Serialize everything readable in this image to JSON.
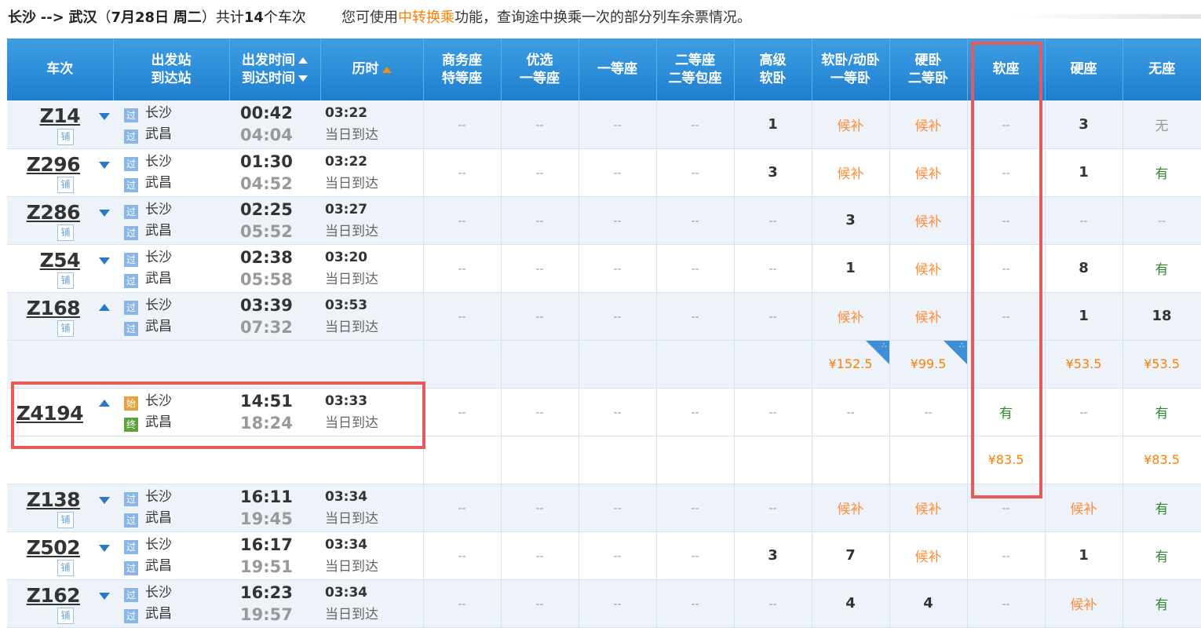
{
  "header": {
    "route_from": "长沙",
    "route_arrow": "-->",
    "route_to": "武汉",
    "date_paren_open": "（",
    "date": "7月28日",
    "weekday": "周二",
    "date_paren_close": "）",
    "total_prefix": "共计",
    "total_count": "14",
    "total_suffix": "个车次",
    "tip_prefix": "您可使用",
    "tip_link": "中转换乘",
    "tip_suffix": "功能，查询途中换乘一次的部分列车余票情况。"
  },
  "columns": {
    "train": "车次",
    "station_1": "出发站",
    "station_2": "到达站",
    "time_1": "出发时间",
    "time_2": "到达时间",
    "duration": "历时",
    "business_1": "商务座",
    "business_2": "特等座",
    "premium_1": "优选",
    "premium_2": "一等座",
    "first": "一等座",
    "second_1": "二等座",
    "second_2": "二等包座",
    "adv_soft_sleeper_1": "高级",
    "adv_soft_sleeper_2": "软卧",
    "soft_sleeper_1": "软卧/动卧",
    "soft_sleeper_2": "一等卧",
    "hard_sleeper_1": "硬卧",
    "hard_sleeper_2": "二等卧",
    "soft_seat": "软座",
    "hard_seat": "硬座",
    "no_seat": "无座"
  },
  "rows": [
    {
      "train": "Z14",
      "sleeper_badge": "铺",
      "arrow": "down",
      "from": "长沙",
      "to": "武昌",
      "from_icon": "过",
      "to_icon": "过",
      "dep": "00:42",
      "arr": "04:04",
      "dur": "03:22",
      "arr_day": "当日到达",
      "seats": [
        "--",
        "--",
        "--",
        "--",
        "1",
        "候补",
        "候补",
        "--",
        "3",
        "无"
      ]
    },
    {
      "train": "Z296",
      "sleeper_badge": "铺",
      "arrow": "down",
      "from": "长沙",
      "to": "武昌",
      "from_icon": "过",
      "to_icon": "过",
      "dep": "01:30",
      "arr": "04:52",
      "dur": "03:22",
      "arr_day": "当日到达",
      "seats": [
        "--",
        "--",
        "--",
        "--",
        "3",
        "候补",
        "候补",
        "--",
        "1",
        "有"
      ]
    },
    {
      "train": "Z286",
      "sleeper_badge": "铺",
      "arrow": "down",
      "from": "长沙",
      "to": "武昌",
      "from_icon": "过",
      "to_icon": "过",
      "dep": "02:25",
      "arr": "05:52",
      "dur": "03:27",
      "arr_day": "当日到达",
      "seats": [
        "--",
        "--",
        "--",
        "--",
        "--",
        "3",
        "候补",
        "--",
        "--",
        "--"
      ]
    },
    {
      "train": "Z54",
      "sleeper_badge": "铺",
      "arrow": "down",
      "from": "长沙",
      "to": "武昌",
      "from_icon": "过",
      "to_icon": "过",
      "dep": "02:38",
      "arr": "05:58",
      "dur": "03:20",
      "arr_day": "当日到达",
      "seats": [
        "--",
        "--",
        "--",
        "--",
        "--",
        "1",
        "候补",
        "--",
        "8",
        "有"
      ]
    },
    {
      "train": "Z168",
      "sleeper_badge": "铺",
      "arrow": "up",
      "from": "长沙",
      "to": "武昌",
      "from_icon": "过",
      "to_icon": "过",
      "dep": "03:39",
      "arr": "07:32",
      "dur": "03:53",
      "arr_day": "当日到达",
      "seats": [
        "--",
        "--",
        "--",
        "--",
        "--",
        "候补",
        "候补",
        "--",
        "1",
        "18"
      ]
    }
  ],
  "price_row_1": [
    "",
    "",
    "",
    "",
    "",
    "¥152.5",
    "¥99.5",
    "",
    "¥53.5",
    "¥53.5"
  ],
  "highlight_train": {
    "train": "Z4194",
    "arrow": "up",
    "from": "长沙",
    "to": "武昌",
    "from_icon": "始",
    "to_icon": "终",
    "dep": "14:51",
    "arr": "18:24",
    "dur": "03:33",
    "arr_day": "当日到达",
    "seats": [
      "--",
      "--",
      "--",
      "--",
      "--",
      "--",
      "--",
      "有",
      "--",
      "有"
    ]
  },
  "price_row_2": [
    "",
    "",
    "",
    "",
    "",
    "",
    "",
    "¥83.5",
    "",
    "¥83.5"
  ],
  "rows_after": [
    {
      "train": "Z138",
      "sleeper_badge": "铺",
      "arrow": "down",
      "from": "长沙",
      "to": "武昌",
      "from_icon": "过",
      "to_icon": "过",
      "dep": "16:11",
      "arr": "19:45",
      "dur": "03:34",
      "arr_day": "当日到达",
      "seats": [
        "--",
        "--",
        "--",
        "--",
        "--",
        "候补",
        "候补",
        "--",
        "候补",
        "有"
      ]
    },
    {
      "train": "Z502",
      "sleeper_badge": "铺",
      "arrow": "down",
      "from": "长沙",
      "to": "武昌",
      "from_icon": "过",
      "to_icon": "过",
      "dep": "16:17",
      "arr": "19:51",
      "dur": "03:34",
      "arr_day": "当日到达",
      "seats": [
        "--",
        "--",
        "--",
        "--",
        "3",
        "7",
        "候补",
        "--",
        "1",
        "有"
      ]
    },
    {
      "train": "Z162",
      "sleeper_badge": "铺",
      "arrow": "down",
      "from": "长沙",
      "to": "武昌",
      "from_icon": "过",
      "to_icon": "过",
      "dep": "16:23",
      "arr": "19:57",
      "dur": "03:34",
      "arr_day": "当日到达",
      "seats": [
        "--",
        "--",
        "--",
        "--",
        "--",
        "4",
        "4",
        "--",
        "候补",
        "有"
      ]
    }
  ],
  "colors": {
    "header_blue": "#1f7fcf",
    "wait_orange": "#ff8c3a",
    "has_green": "#2d8a2d",
    "highlight_red": "#e85a5a",
    "price_orange": "#ff7f00"
  }
}
